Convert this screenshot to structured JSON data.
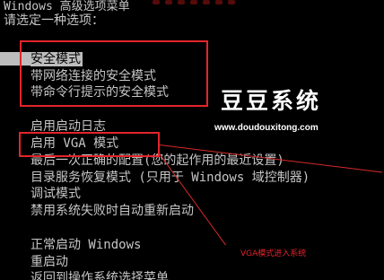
{
  "header": {
    "title": "Windows 高级选项菜单",
    "prompt": "请选定一种选项："
  },
  "menu": {
    "safe_modes": [
      {
        "label": "安全模式",
        "selected": true
      },
      {
        "label": "带网络连接的安全模式"
      },
      {
        "label": "带命令行提示的安全模式"
      }
    ],
    "other_options": [
      {
        "label": "启用启动日志"
      },
      {
        "label": "启用 VGA 模式"
      },
      {
        "label": "最后一次正确的配置(您的起作用的最近设置)"
      },
      {
        "label": "目录服务恢复模式 (只用于 Windows 域控制器)"
      },
      {
        "label": "调试模式"
      },
      {
        "label": "禁用系统失败时自动重新启动"
      }
    ],
    "boot_options": [
      {
        "label": "正常启动 Windows"
      },
      {
        "label": "重启动"
      },
      {
        "label": "返回到操作系统选择菜单"
      }
    ]
  },
  "watermark": {
    "brand": "豆豆系统",
    "url": "www.doudouxitong.com"
  },
  "annotation": {
    "text": "VGA模式进入系统"
  },
  "colors": {
    "background": "#000000",
    "text": "#c6c6c6",
    "selection": "#bdbdbd",
    "annotation_red": "#e3242b"
  }
}
